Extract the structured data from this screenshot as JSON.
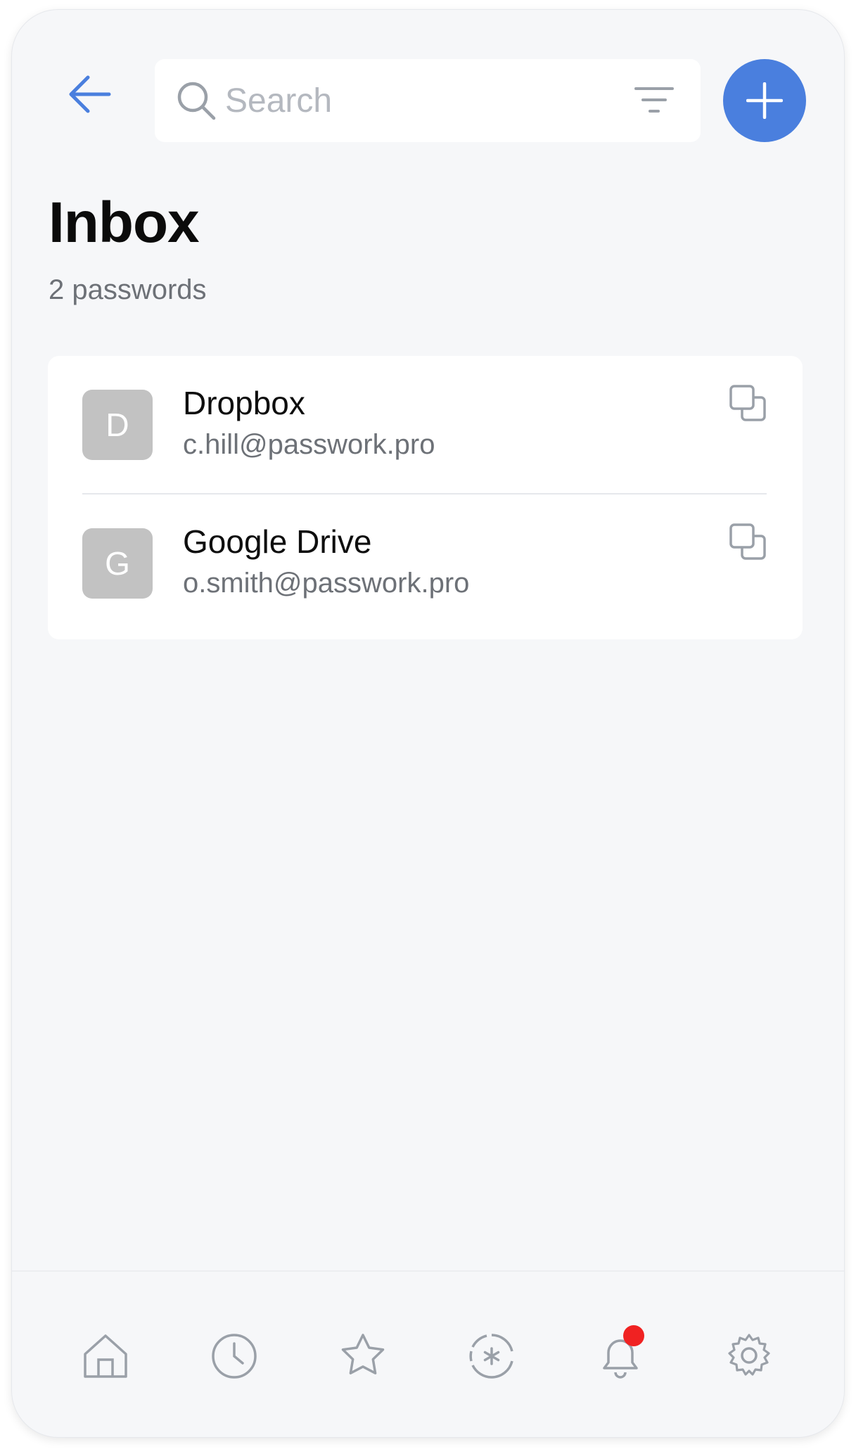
{
  "colors": {
    "accent": "#4a7fde",
    "avatar_bg": "#c2c2c2",
    "notification_dot": "#f02222",
    "icon_gray": "#9aa0a8"
  },
  "header": {
    "back_icon": "arrow-left-icon",
    "search": {
      "placeholder": "Search",
      "value": "",
      "icon": "search-icon",
      "filter_icon": "filter-icon"
    },
    "add_icon": "plus-icon"
  },
  "page": {
    "title": "Inbox",
    "subtitle": "2 passwords"
  },
  "passwords": [
    {
      "letter": "D",
      "title": "Dropbox",
      "login": "c.hill@passwork.pro",
      "action_icon": "copy-icon"
    },
    {
      "letter": "G",
      "title": "Google Drive",
      "login": "o.smith@passwork.pro",
      "action_icon": "copy-icon"
    }
  ],
  "bottom_nav": [
    {
      "icon": "home-icon"
    },
    {
      "icon": "clock-icon"
    },
    {
      "icon": "star-icon"
    },
    {
      "icon": "password-generator-icon"
    },
    {
      "icon": "bell-icon",
      "has_notification": true
    },
    {
      "icon": "gear-icon"
    }
  ]
}
